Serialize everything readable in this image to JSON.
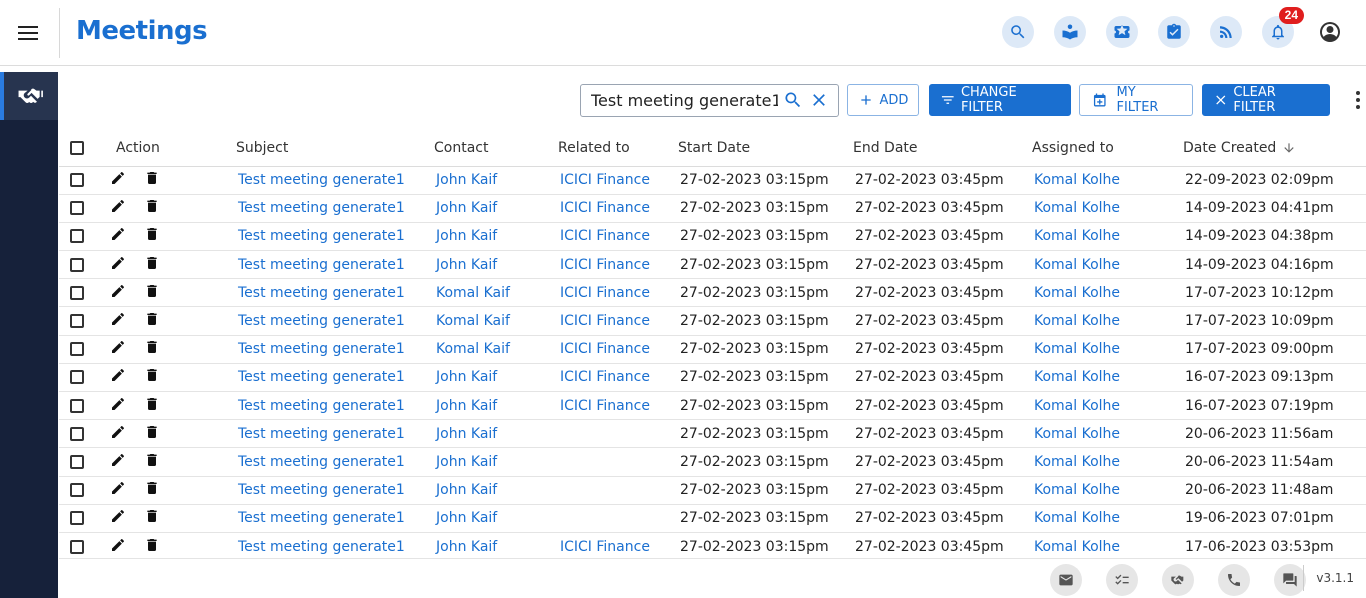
{
  "header": {
    "title": "Meetings",
    "notification_count": "24",
    "icons": [
      "search-icon",
      "knowledge-base-icon",
      "tickets-icon",
      "tasks-icon",
      "feeds-icon",
      "notification-bell-icon",
      "user-account-icon"
    ]
  },
  "sidebar": {
    "items": [
      {
        "icon": "handshake-icon",
        "active": true
      }
    ]
  },
  "toolbar": {
    "search_value": "Test meeting generate1",
    "add_label": "ADD",
    "change_filter_label": "CHANGE FILTER",
    "my_filter_label": "MY FILTER",
    "clear_filter_label": "CLEAR FILTER"
  },
  "table": {
    "columns": [
      "Action",
      "Subject",
      "Contact",
      "Related to",
      "Start Date",
      "End Date",
      "Assigned to",
      "Date Created"
    ],
    "rows": [
      {
        "subject": "Test meeting generate1",
        "contact": "John Kaif",
        "related": "ICICI Finance",
        "start": "27-02-2023 03:15pm",
        "end": "27-02-2023 03:45pm",
        "assigned": "Komal Kolhe",
        "created": "22-09-2023 02:09pm"
      },
      {
        "subject": "Test meeting generate1",
        "contact": "John Kaif",
        "related": "ICICI Finance",
        "start": "27-02-2023 03:15pm",
        "end": "27-02-2023 03:45pm",
        "assigned": "Komal Kolhe",
        "created": "14-09-2023 04:41pm"
      },
      {
        "subject": "Test meeting generate1",
        "contact": "John Kaif",
        "related": "ICICI Finance",
        "start": "27-02-2023 03:15pm",
        "end": "27-02-2023 03:45pm",
        "assigned": "Komal Kolhe",
        "created": "14-09-2023 04:38pm"
      },
      {
        "subject": "Test meeting generate1",
        "contact": "John Kaif",
        "related": "ICICI Finance",
        "start": "27-02-2023 03:15pm",
        "end": "27-02-2023 03:45pm",
        "assigned": "Komal Kolhe",
        "created": "14-09-2023 04:16pm"
      },
      {
        "subject": "Test meeting generate1",
        "contact": "Komal Kaif",
        "related": "ICICI Finance",
        "start": "27-02-2023 03:15pm",
        "end": "27-02-2023 03:45pm",
        "assigned": "Komal Kolhe",
        "created": "17-07-2023 10:12pm"
      },
      {
        "subject": "Test meeting generate1",
        "contact": "Komal Kaif",
        "related": "ICICI Finance",
        "start": "27-02-2023 03:15pm",
        "end": "27-02-2023 03:45pm",
        "assigned": "Komal Kolhe",
        "created": "17-07-2023 10:09pm"
      },
      {
        "subject": "Test meeting generate1",
        "contact": "Komal Kaif",
        "related": "ICICI Finance",
        "start": "27-02-2023 03:15pm",
        "end": "27-02-2023 03:45pm",
        "assigned": "Komal Kolhe",
        "created": "17-07-2023 09:00pm"
      },
      {
        "subject": "Test meeting generate1",
        "contact": "John Kaif",
        "related": "ICICI Finance",
        "start": "27-02-2023 03:15pm",
        "end": "27-02-2023 03:45pm",
        "assigned": "Komal Kolhe",
        "created": "16-07-2023 09:13pm"
      },
      {
        "subject": "Test meeting generate1",
        "contact": "John Kaif",
        "related": "ICICI Finance",
        "start": "27-02-2023 03:15pm",
        "end": "27-02-2023 03:45pm",
        "assigned": "Komal Kolhe",
        "created": "16-07-2023 07:19pm"
      },
      {
        "subject": "Test meeting generate1",
        "contact": "John Kaif",
        "related": "",
        "start": "27-02-2023 03:15pm",
        "end": "27-02-2023 03:45pm",
        "assigned": "Komal Kolhe",
        "created": "20-06-2023 11:56am"
      },
      {
        "subject": "Test meeting generate1",
        "contact": "John Kaif",
        "related": "",
        "start": "27-02-2023 03:15pm",
        "end": "27-02-2023 03:45pm",
        "assigned": "Komal Kolhe",
        "created": "20-06-2023 11:54am"
      },
      {
        "subject": "Test meeting generate1",
        "contact": "John Kaif",
        "related": "",
        "start": "27-02-2023 03:15pm",
        "end": "27-02-2023 03:45pm",
        "assigned": "Komal Kolhe",
        "created": "20-06-2023 11:48am"
      },
      {
        "subject": "Test meeting generate1",
        "contact": "John Kaif",
        "related": "",
        "start": "27-02-2023 03:15pm",
        "end": "27-02-2023 03:45pm",
        "assigned": "Komal Kolhe",
        "created": "19-06-2023 07:01pm"
      },
      {
        "subject": "Test meeting generate1",
        "contact": "John Kaif",
        "related": "ICICI Finance",
        "start": "27-02-2023 03:15pm",
        "end": "27-02-2023 03:45pm",
        "assigned": "Komal Kolhe",
        "created": "17-06-2023 03:53pm"
      }
    ]
  },
  "footer": {
    "icons": [
      "email-icon",
      "checklist-icon",
      "handshake-icon",
      "phone-icon",
      "chat-icon"
    ],
    "version": "v3.1.1"
  },
  "colors": {
    "accent": "#1a6fd0",
    "sidebar_bg": "#16213a",
    "badge": "#e01e1e"
  }
}
